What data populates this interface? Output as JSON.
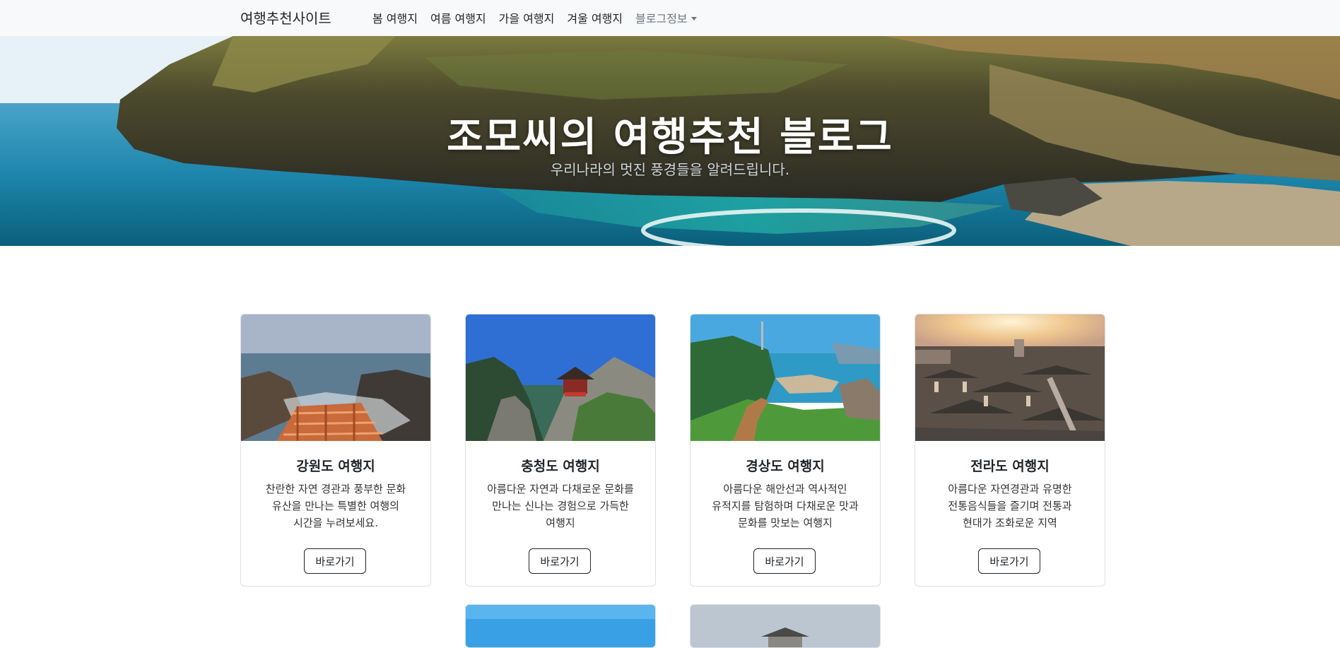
{
  "navbar": {
    "brand": "여행추천사이트",
    "links": [
      {
        "label": "봄 여행지"
      },
      {
        "label": "여름 여행지"
      },
      {
        "label": "가을 여행지"
      },
      {
        "label": "겨울 여행지"
      },
      {
        "label": "블로그정보",
        "dropdown": true
      }
    ]
  },
  "hero": {
    "title": "조모씨의 여행추천 블로그",
    "subtitle": "우리나라의 멋진 풍경들을 알려드립니다."
  },
  "cards": [
    {
      "title": "강원도 여행지",
      "text": "찬란한 자연 경관과 풍부한 문화 유산을 만나는 특별한 여행의 시간을 누려보세요.",
      "button": "바로가기",
      "image": "coastal-rocks-boardwalk"
    },
    {
      "title": "충청도 여행지",
      "text": "아름다운 자연과 다채로운 문화를 만나는 신나는 경험으로 가득한 여행지",
      "button": "바로가기",
      "image": "pavilion-on-cliff"
    },
    {
      "title": "경상도 여행지",
      "text": "아름다운 해안선과 역사적인 유적지를 탐험하며 다채로운 맛과 문화를 맛보는 여행지",
      "button": "바로가기",
      "image": "seaside-park-stairs"
    },
    {
      "title": "전라도 여행지",
      "text": "아름다운 자연경관과 유명한 전통음식들을 즐기며 전통과 현대가 조화로운 지역",
      "button": "바로가기",
      "image": "hanok-village-sunset"
    }
  ],
  "partial_cards": [
    {
      "image": "blue-sky"
    },
    {
      "image": "palace-gate"
    }
  ],
  "colors": {
    "navbar_bg": "#f8f9fa",
    "text": "#212529",
    "muted": "#6c757d",
    "card_border": "#dcdfe2"
  }
}
